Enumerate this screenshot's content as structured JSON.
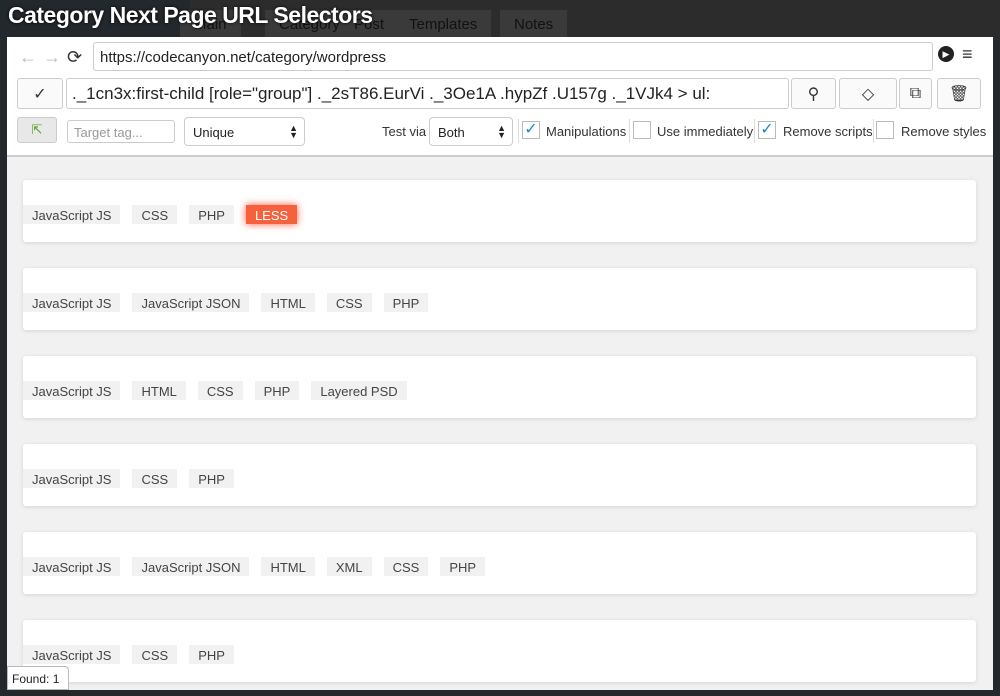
{
  "window_title": "Category Next Page URL Selectors",
  "background_tabs": [
    "Main",
    "Category",
    "Post",
    "Templates",
    "Notes"
  ],
  "toolbar": {
    "url": "https://codecanyon.net/category/wordpress",
    "selector": "._1cn3x:first-child [role=\"group\"] ._2sT86.EurVi ._3Oe1A .hypZf .U157g ._1VJk4 > ul:",
    "target_tag_placeholder": "Target tag...",
    "mode_select": "Unique",
    "test_via_label": "Test via",
    "test_via_select": "Both",
    "options": [
      {
        "label": "Manipulations",
        "checked": true
      },
      {
        "label": "Use immediately",
        "checked": false
      },
      {
        "label": "Remove scripts",
        "checked": true
      },
      {
        "label": "Remove styles",
        "checked": false
      }
    ]
  },
  "highlight_color": "#f5603d",
  "results": [
    {
      "tags": [
        "JavaScript JS",
        "CSS",
        "PHP",
        "LESS"
      ],
      "highlighted": "LESS"
    },
    {
      "tags": [
        "JavaScript JS",
        "JavaScript JSON",
        "HTML",
        "CSS",
        "PHP"
      ]
    },
    {
      "tags": [
        "JavaScript JS",
        "HTML",
        "CSS",
        "PHP",
        "Layered PSD"
      ]
    },
    {
      "tags": [
        "JavaScript JS",
        "CSS",
        "PHP"
      ]
    },
    {
      "tags": [
        "JavaScript JS",
        "JavaScript JSON",
        "HTML",
        "XML",
        "CSS",
        "PHP"
      ]
    },
    {
      "tags": [
        "JavaScript JS",
        "CSS",
        "PHP"
      ]
    }
  ],
  "found_label": "Found: 1"
}
